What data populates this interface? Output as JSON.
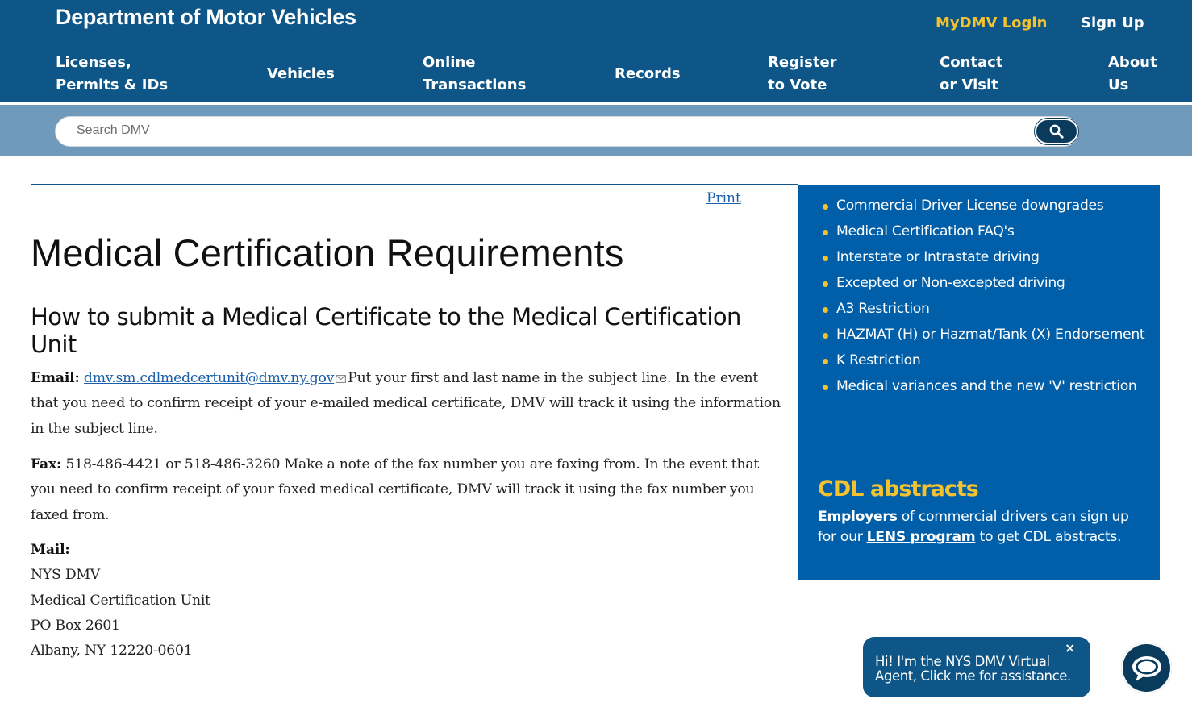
{
  "header": {
    "brand": "Department of Motor Vehicles",
    "login_label": "MyDMV Login",
    "signup_label": "Sign Up",
    "nav": [
      {
        "line1": "Licenses,",
        "line2": "Permits & IDs"
      },
      {
        "line1": "Vehicles",
        "line2": ""
      },
      {
        "line1": "Online",
        "line2": "Transactions"
      },
      {
        "line1": "Records",
        "line2": ""
      },
      {
        "line1": "Register",
        "line2": "to Vote"
      },
      {
        "line1": "Contact",
        "line2": "or Visit"
      },
      {
        "line1": "About",
        "line2": "Us"
      }
    ]
  },
  "search": {
    "placeholder": "Search DMV",
    "button_icon": "search-icon"
  },
  "main": {
    "print_label": "Print",
    "title": "Medical Certification Requirements",
    "heading": "How to submit a Medical Certificate to the Medical Certification Unit",
    "email": {
      "label": "Email:",
      "address": "dmv.sm.cdlmedcertunit@dmv.ny.gov",
      "text": "Put your first and last name in the subject line.  In the event that you need to confirm receipt of your e-mailed medical certificate, DMV will track it using the information in the subject line."
    },
    "fax": {
      "label": "Fax:",
      "text": "518-486-4421 or 518-486-3260 Make a note of the fax number you are faxing from.  In the event that you need to confirm receipt of your faxed  medical certificate, DMV will track it using the fax number you faxed from."
    },
    "mail": {
      "label": "Mail:",
      "lines": [
        "NYS DMV",
        "Medical Certification Unit",
        "PO Box 2601",
        "Albany, NY  12220-0601"
      ]
    }
  },
  "sidebar": {
    "links": [
      "Commercial Driver License downgrades",
      "Medical Certification FAQ's",
      "Interstate or Intrastate driving",
      "Excepted or Non-excepted driving",
      "A3 Restriction",
      "HAZMAT (H) or Hazmat/Tank (X) Endorsement",
      "K Restriction",
      "Medical variances and the new 'V' restriction"
    ],
    "cdl_heading": "CDL abstracts",
    "cdl_text": {
      "employers": "Employers",
      "part1": " of commercial drivers can sign up for our ",
      "lens": "LENS program",
      "part2": " to get CDL abstracts."
    }
  },
  "chat": {
    "message": "Hi! I'm the NYS DMV Virtual Agent, Click me for assistance.",
    "close": "×",
    "launcher_icon": "chat-bubble-icon"
  },
  "colors": {
    "header_bg": "#0d5687",
    "search_band": "#6f9abb",
    "sidebar_bg": "#005fa8",
    "accent_yellow": "#f2c230",
    "link_blue": "#1a5ea8"
  }
}
